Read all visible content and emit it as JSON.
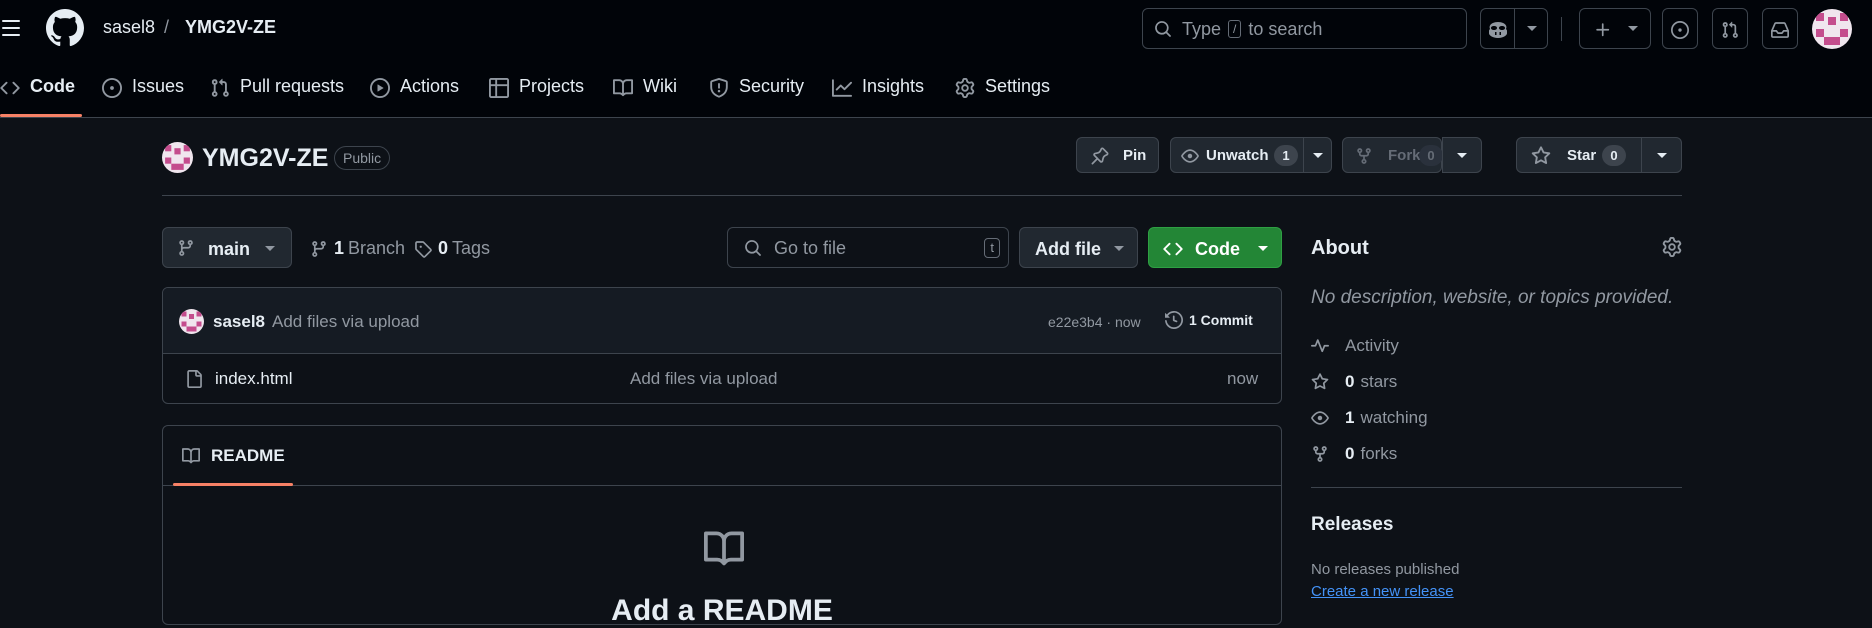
{
  "header": {
    "owner": "sasel8",
    "separator": "/",
    "repo": "YMG2V-ZE",
    "search": {
      "prefix": "Type",
      "key": "/",
      "suffix": "to search"
    }
  },
  "nav": [
    {
      "label": "Code",
      "icon": "code-icon",
      "active": true
    },
    {
      "label": "Issues",
      "icon": "issue-icon"
    },
    {
      "label": "Pull requests",
      "icon": "pull-request-icon"
    },
    {
      "label": "Actions",
      "icon": "play-icon"
    },
    {
      "label": "Projects",
      "icon": "table-icon"
    },
    {
      "label": "Wiki",
      "icon": "book-icon"
    },
    {
      "label": "Security",
      "icon": "shield-icon"
    },
    {
      "label": "Insights",
      "icon": "graph-icon"
    },
    {
      "label": "Settings",
      "icon": "gear-icon"
    }
  ],
  "repo": {
    "name": "YMG2V-ZE",
    "visibility": "Public",
    "pin": "Pin",
    "unwatch": "Unwatch",
    "watch_count": "1",
    "fork": "Fork",
    "fork_count": "0",
    "star": "Star",
    "star_count": "0"
  },
  "toolbar": {
    "branch": "main",
    "branches_count": "1",
    "branches_label": "Branch",
    "tags_count": "0",
    "tags_label": "Tags",
    "go_to_file": "Go to file",
    "go_to_file_key": "t",
    "add_file": "Add file",
    "code": "Code"
  },
  "commit": {
    "author": "sasel8",
    "message": "Add files via upload",
    "hash_time": "e22e3b4 · now",
    "commits": "1 Commit"
  },
  "files": [
    {
      "name": "index.html",
      "message": "Add files via upload",
      "time": "now",
      "icon": "file-icon"
    }
  ],
  "readme": {
    "tab": "README",
    "title": "Add a README"
  },
  "about": {
    "heading": "About",
    "description": "No description, website, or topics provided.",
    "activity": "Activity",
    "stars_count": "0",
    "stars_label": "stars",
    "watching_count": "1",
    "watching_label": "watching",
    "forks_count": "0",
    "forks_label": "forks"
  },
  "releases": {
    "heading": "Releases",
    "none": "No releases published",
    "create": "Create a new release"
  },
  "colors": {
    "background": "#0d1117",
    "header": "#010409",
    "accent_underline": "#f78166",
    "green_button": "#238636",
    "link": "#4493f8"
  }
}
